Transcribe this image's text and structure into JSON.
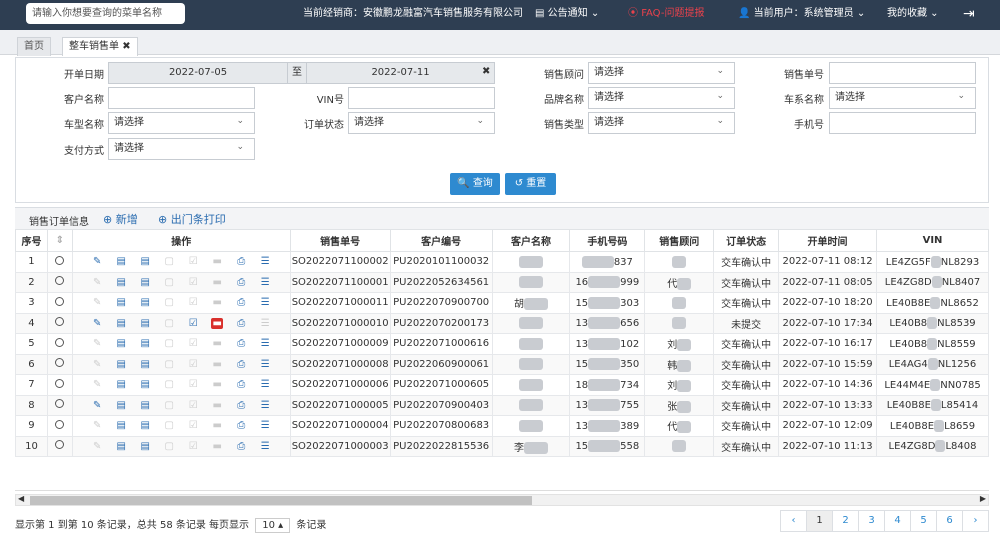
{
  "topbar": {
    "search_placeholder": "请输入你想要查询的菜单名称",
    "dealer": "当前经销商：安徽鹏龙融富汽车销售服务有限公司",
    "notice": "公告通知",
    "faq": "FAQ-问题提报",
    "user": "当前用户：系统管理员",
    "favorites": "我的收藏"
  },
  "tabs": {
    "home": "首页",
    "current": "整车销售单"
  },
  "form": {
    "date_label": "开单日期",
    "date_start": "2022-07-05",
    "date_sep": "至",
    "date_end": "2022-07-11",
    "customer_label": "客户名称",
    "model_label": "车型名称",
    "model_value": "请选择",
    "pay_label": "支付方式",
    "pay_value": "请选择",
    "vin_label": "VIN号",
    "status_label": "订单状态",
    "status_value": "请选择",
    "advisor_label": "销售顾问",
    "advisor_value": "请选择",
    "brand_label": "品牌名称",
    "brand_value": "请选择",
    "saletype_label": "销售类型",
    "saletype_value": "请选择",
    "orderno_label": "销售单号",
    "series_label": "车系名称",
    "series_value": "请选择",
    "phone_label": "手机号",
    "query_btn": "查询",
    "reset_btn": "重置"
  },
  "toolbar": {
    "title": "销售订单信息",
    "add": "新增",
    "print": "出门条打印"
  },
  "table": {
    "headers": [
      "序号",
      "操作",
      "销售单号",
      "客户编号",
      "客户名称",
      "手机号码",
      "销售顾问",
      "订单状态",
      "开单时间",
      "VIN"
    ],
    "rows": [
      [
        "1",
        "SO2022071100002",
        "PU2020101100032",
        "",
        "",
        "837",
        "",
        "交车确认中",
        "2022-07-11 08:12",
        "LE4ZG5F",
        "NL8293"
      ],
      [
        "2",
        "SO2022071100001",
        "PU2022052634561",
        "",
        "16",
        "999",
        "代",
        "交车确认中",
        "2022-07-11 08:05",
        "LE4ZG8D",
        "NL8407"
      ],
      [
        "3",
        "SO2022071000011",
        "PU2022070900700",
        "胡",
        "15",
        "303",
        "",
        "交车确认中",
        "2022-07-10 18:20",
        "LE40B8E",
        "NL8652"
      ],
      [
        "4",
        "SO2022071000010",
        "PU2022070200173",
        "",
        "13",
        "656",
        "",
        "未提交",
        "2022-07-10 17:34",
        "LE40B8",
        "NL8539"
      ],
      [
        "5",
        "SO2022071000009",
        "PU2022071000616",
        "",
        "13",
        "102",
        "刘",
        "交车确认中",
        "2022-07-10 16:17",
        "LE40B8",
        "NL8559"
      ],
      [
        "6",
        "SO2022071000008",
        "PU2022060900061",
        "",
        "15",
        "350",
        "韩",
        "交车确认中",
        "2022-07-10 15:59",
        "LE4AG4",
        "NL1256"
      ],
      [
        "7",
        "SO2022071000006",
        "PU2022071000605",
        "",
        "18",
        "734",
        "刘",
        "交车确认中",
        "2022-07-10 14:36",
        "LE44M4E",
        "NN0785"
      ],
      [
        "8",
        "SO2022071000005",
        "PU2022070900403",
        "",
        "13",
        "755",
        "张",
        "交车确认中",
        "2022-07-10 13:33",
        "LE40B8E",
        "L85414"
      ],
      [
        "9",
        "SO2022071000004",
        "PU2022070800683",
        "",
        "13",
        "389",
        "代",
        "交车确认中",
        "2022-07-10 12:09",
        "LE40B8E",
        "L8659"
      ],
      [
        "10",
        "SO2022071000003",
        "PU2022022815536",
        "李",
        "15",
        "558",
        "",
        "交车确认中",
        "2022-07-10 11:13",
        "LE4ZG8D",
        "L8408"
      ]
    ]
  },
  "footer": {
    "summary": "显示第 1 到第 10 条记录，总共 58 条记录 每页显示",
    "page_size": "10",
    "suffix": "条记录"
  },
  "pagination": {
    "prev": "‹",
    "pages": [
      "1",
      "2",
      "3",
      "4",
      "5",
      "6"
    ],
    "next": "›"
  }
}
